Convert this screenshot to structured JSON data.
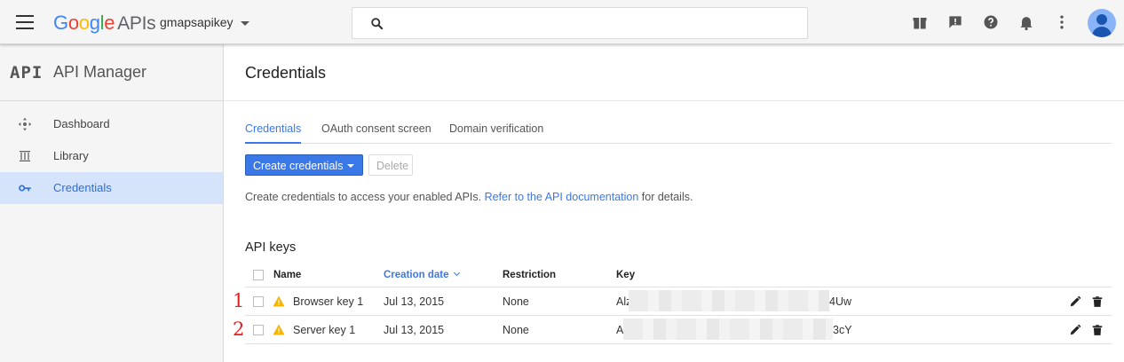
{
  "header": {
    "logo": {
      "g1": "G",
      "g2": "o",
      "g3": "o",
      "g4": "g",
      "g5": "l",
      "g6": "e",
      "apis": "APIs"
    },
    "project": "gmapsapikey",
    "search": {
      "value": "",
      "placeholder": ""
    },
    "icons": [
      "gift-icon",
      "feedback-icon",
      "help-icon",
      "notifications-icon",
      "more-vert-icon",
      "account-avatar"
    ]
  },
  "sidebar": {
    "logo": "API",
    "title": "API Manager",
    "items": [
      {
        "label": "Dashboard",
        "icon": "dashboard-icon",
        "active": false
      },
      {
        "label": "Library",
        "icon": "library-icon",
        "active": false
      },
      {
        "label": "Credentials",
        "icon": "key-icon",
        "active": true
      }
    ]
  },
  "main": {
    "title": "Credentials",
    "tabs": [
      {
        "label": "Credentials",
        "active": true
      },
      {
        "label": "OAuth consent screen",
        "active": false
      },
      {
        "label": "Domain verification",
        "active": false
      }
    ],
    "create_button": "Create credentials",
    "delete_button": "Delete",
    "help": {
      "before": "Create credentials to access your enabled APIs. ",
      "link": "Refer to the API documentation",
      "after": " for details."
    },
    "section_title": "API keys",
    "table": {
      "columns": {
        "name": "Name",
        "creation_date": "Creation date",
        "restriction": "Restriction",
        "key": "Key"
      },
      "rows": [
        {
          "annotation": "1",
          "name": "Browser key 1",
          "date": "Jul 13, 2015",
          "restriction": "None",
          "key_start": "Alz",
          "key_end": "4Uw"
        },
        {
          "annotation": "2",
          "name": "Server key 1",
          "date": "Jul 13, 2015",
          "restriction": "None",
          "key_start": "Al",
          "key_end": "3cY"
        }
      ]
    }
  },
  "colors": {
    "accent": "#3b78e7",
    "warning": "#f4b400",
    "annotation": "#e02020",
    "sidebar_active": "#d6e4fb"
  }
}
